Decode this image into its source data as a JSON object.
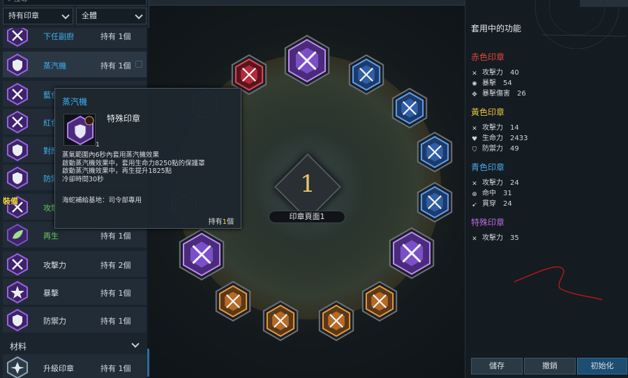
{
  "search": {
    "placeholder": "搜尋"
  },
  "filters": {
    "owned": "持有印章",
    "scope": "全體"
  },
  "list": {
    "rows": [
      {
        "name": "下任副廚",
        "owned": "持有 1個",
        "color": "blue",
        "icon": "purple-sword-seal"
      },
      {
        "name": "蒸汽機",
        "owned": "持有 1個",
        "color": "blue",
        "icon": "purple-shield-seal",
        "locked": true
      },
      {
        "name": "藍色",
        "owned": "",
        "color": "blue",
        "icon": "purple-sword-seal"
      },
      {
        "name": "紅色",
        "owned": "",
        "color": "blue",
        "icon": "purple-sword-seal"
      },
      {
        "name": "對應",
        "owned": "",
        "color": "blue",
        "icon": "purple-shield-seal"
      },
      {
        "name": "防禦",
        "owned": "",
        "color": "blue",
        "icon": "purple-shield-seal"
      },
      {
        "name": "攻擊",
        "owned": "",
        "color": "green",
        "icon": "purple-sword-seal"
      },
      {
        "name": "再生",
        "owned": "持有 1個",
        "color": "green",
        "icon": "purple-leaf-seal"
      },
      {
        "name": "攻擊力",
        "owned": "持有 2個",
        "color": "white",
        "icon": "purple-sword-seal"
      },
      {
        "name": "暴擊",
        "owned": "持有 1個",
        "color": "white",
        "icon": "purple-star-seal"
      },
      {
        "name": "防禦力",
        "owned": "持有 1個",
        "color": "white",
        "icon": "purple-shield-seal"
      }
    ],
    "equip_tag": "裝備",
    "section_label": "材料",
    "material": {
      "name": "升級印章",
      "owned": "持有 1個",
      "icon": "upgrade-seal"
    }
  },
  "tooltip": {
    "name": "蒸汽機",
    "count": "1",
    "type": "特殊印章",
    "desc": [
      "蒸氣範圍內6秒內套用蒸汽機效果",
      "啟動蒸汽機效果中，套用生命力8250點的保護罩",
      "啟動蒸汽機效果中，再生提升1825點",
      "冷卻時間30秒"
    ],
    "exclusive": "海蛇補給基地：司令部專用",
    "owned_label": "持有",
    "owned_num": "1",
    "owned_unit": "個"
  },
  "board": {
    "page_number": "1",
    "page_label": "印章頁面1"
  },
  "effects": {
    "title": "套用中的功能",
    "groups": [
      {
        "name": "赤色印章",
        "color": "#e0473a",
        "stats": [
          {
            "icon": "crossed-swords-icon",
            "label": "攻擊力",
            "value": "40"
          },
          {
            "icon": "burst-icon",
            "label": "暴擊",
            "value": "54"
          },
          {
            "icon": "crit-damage-icon",
            "label": "暴擊傷害",
            "value": "26"
          }
        ]
      },
      {
        "name": "黃色印章",
        "color": "#e7c43a",
        "stats": [
          {
            "icon": "crossed-swords-icon",
            "label": "攻擊力",
            "value": "14"
          },
          {
            "icon": "heart-icon",
            "label": "生命力",
            "value": "2433"
          },
          {
            "icon": "shield-icon",
            "label": "防禦力",
            "value": "49"
          }
        ]
      },
      {
        "name": "青色印章",
        "color": "#4aa8e8",
        "stats": [
          {
            "icon": "crossed-swords-icon",
            "label": "攻擊力",
            "value": "24"
          },
          {
            "icon": "target-icon",
            "label": "命中",
            "value": "31"
          },
          {
            "icon": "pierce-icon",
            "label": "貫穿",
            "value": "24"
          }
        ]
      },
      {
        "name": "特殊印章",
        "color": "#b86ae0",
        "stats": [
          {
            "icon": "crossed-swords-icon",
            "label": "攻擊力",
            "value": "35"
          }
        ]
      }
    ]
  },
  "buttons": {
    "save": "儲存",
    "cancel": "撤銷",
    "reset": "初始化"
  }
}
